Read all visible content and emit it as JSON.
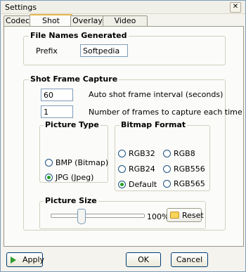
{
  "window": {
    "title": "Settings",
    "close_glyph": "✕"
  },
  "tabs": [
    {
      "label": "Codec"
    },
    {
      "label": "Shot Frame"
    },
    {
      "label": "Overlay"
    },
    {
      "label": "Video Effect"
    }
  ],
  "file_names": {
    "title": "File Names Generated",
    "prefix_label": "Prefix",
    "prefix_value": "Softpedia"
  },
  "shot_frame_capture": {
    "title": "Shot Frame Capture",
    "interval_value": "60",
    "interval_label": "Auto shot frame interval (seconds)",
    "frames_value": "1",
    "frames_label": "Number of frames to capture each time"
  },
  "picture_type": {
    "title": "Picture Type",
    "options": [
      {
        "label": "BMP (Bitmap)",
        "checked": false
      },
      {
        "label": "JPG (Jpeg)",
        "checked": true
      }
    ]
  },
  "bitmap_format": {
    "title": "Bitmap Format",
    "options": [
      {
        "label": "RGB32",
        "checked": false
      },
      {
        "label": "RGB8",
        "checked": false
      },
      {
        "label": "RGB24",
        "checked": false
      },
      {
        "label": "RGB556",
        "checked": false
      },
      {
        "label": "Default",
        "checked": true
      },
      {
        "label": "RGB565",
        "checked": false
      }
    ]
  },
  "picture_size": {
    "title": "Picture Size",
    "value_percent": "100%",
    "reset_label": "Reset"
  },
  "footer": {
    "apply_label": "Apply",
    "ok_label": "OK",
    "cancel_label": "Cancel"
  },
  "icons": {
    "close": "close-icon",
    "apply": "apply-icon",
    "reset": "reset-icon"
  }
}
